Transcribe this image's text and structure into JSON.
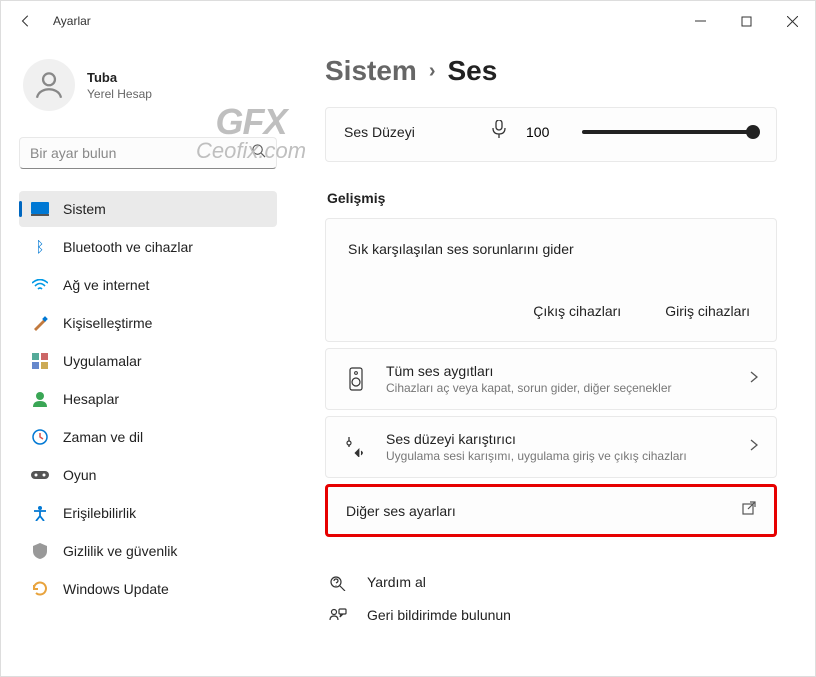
{
  "titlebar": {
    "title": "Ayarlar"
  },
  "user": {
    "name": "Tuba",
    "subtitle": "Yerel Hesap"
  },
  "search": {
    "placeholder": "Bir ayar bulun"
  },
  "nav": {
    "items": [
      {
        "label": "Sistem"
      },
      {
        "label": "Bluetooth ve cihazlar"
      },
      {
        "label": "Ağ ve internet"
      },
      {
        "label": "Kişiselleştirme"
      },
      {
        "label": "Uygulamalar"
      },
      {
        "label": "Hesaplar"
      },
      {
        "label": "Zaman ve dil"
      },
      {
        "label": "Oyun"
      },
      {
        "label": "Erişilebilirlik"
      },
      {
        "label": "Gizlilik ve güvenlik"
      },
      {
        "label": "Windows Update"
      }
    ]
  },
  "breadcrumb": {
    "parent": "Sistem",
    "sep": "›",
    "current": "Ses"
  },
  "volume": {
    "label": "Ses Düzeyi",
    "value": "100"
  },
  "advanced": {
    "heading": "Gelişmiş",
    "troubleshoot": {
      "title": "Sık karşılaşılan ses sorunlarını gider",
      "output": "Çıkış cihazları",
      "input": "Giriş cihazları"
    },
    "allDevices": {
      "title": "Tüm ses aygıtları",
      "sub": "Cihazları aç veya kapat, sorun gider, diğer seçenekler"
    },
    "mixer": {
      "title": "Ses düzeyi karıştırıcı",
      "sub": "Uygulama sesi karışımı, uygulama giriş ve çıkış cihazları"
    },
    "other": {
      "title": "Diğer ses ayarları"
    }
  },
  "help": {
    "get": "Yardım al",
    "feedback": "Geri bildirimde bulunun"
  },
  "watermark": {
    "line1": "GFX",
    "line2": "Ceofix.com"
  }
}
